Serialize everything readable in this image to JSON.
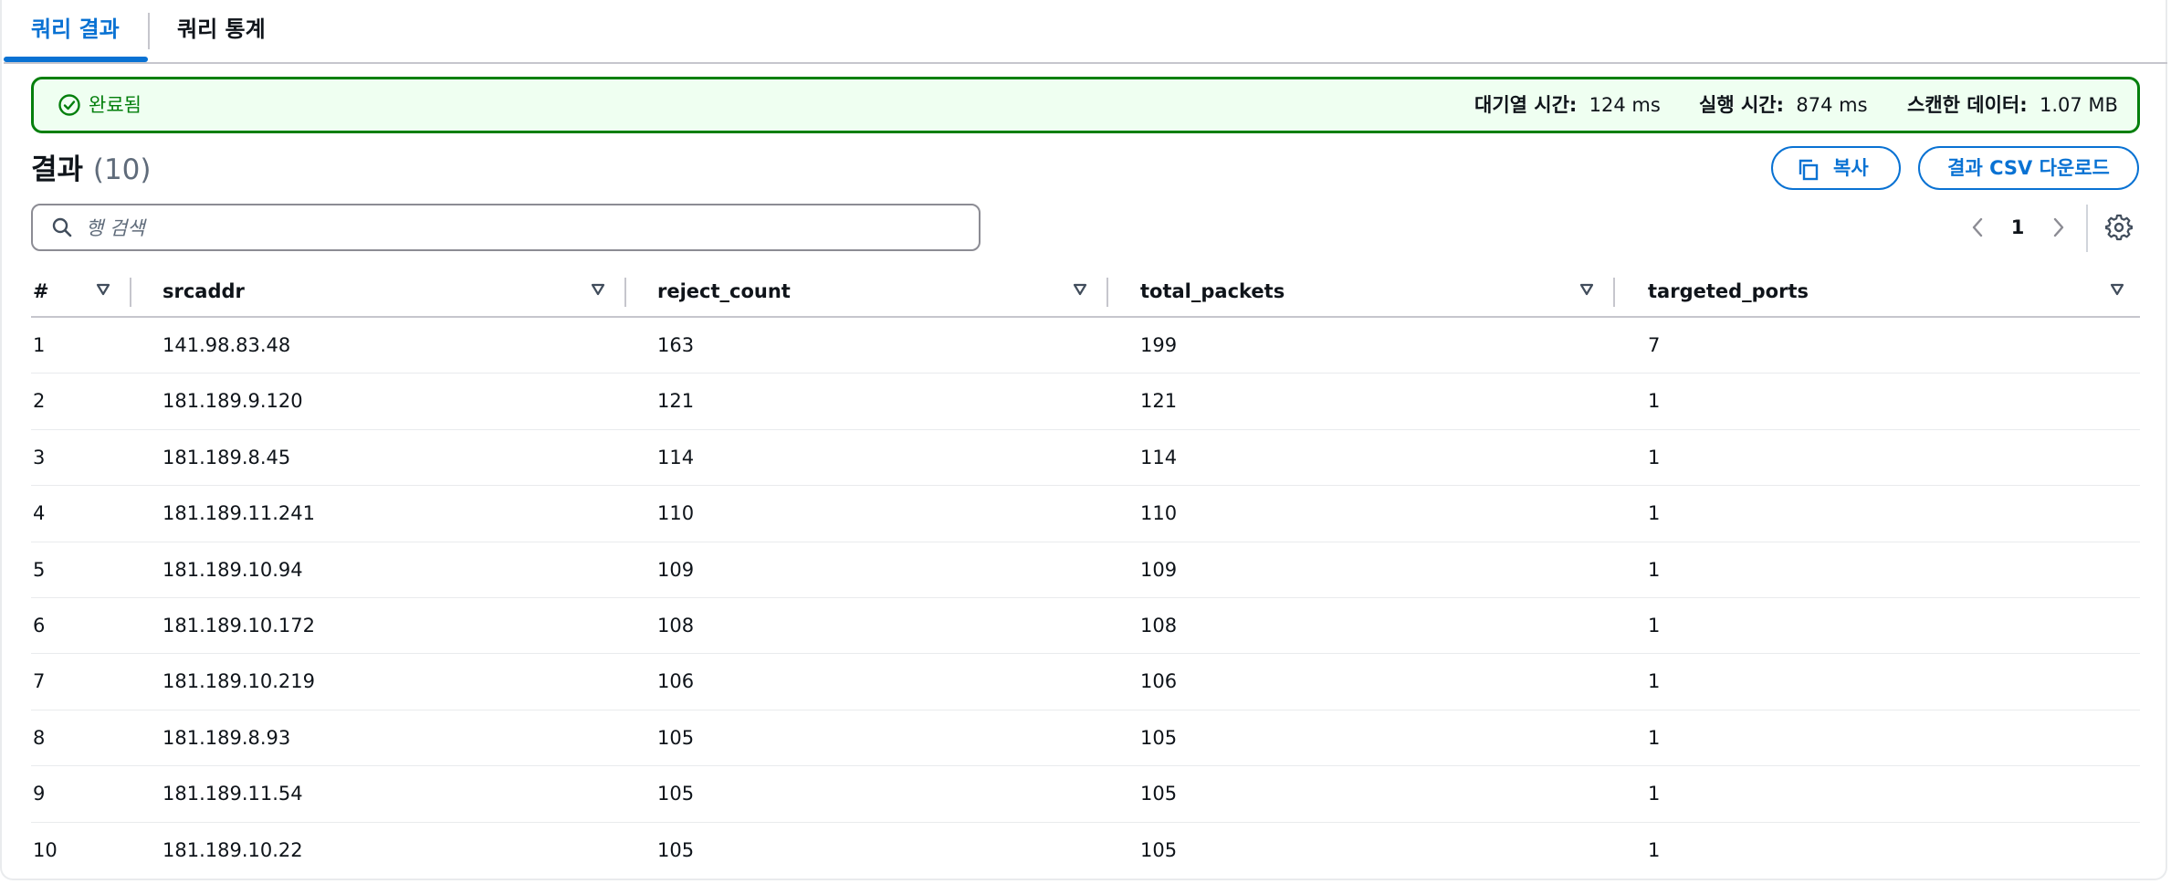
{
  "tabs": [
    {
      "label": "쿼리 결과",
      "active": true
    },
    {
      "label": "쿼리 통계",
      "active": false
    }
  ],
  "status": {
    "text": "완료됨",
    "color": "#037f0c",
    "queue_time_label": "대기열 시간:",
    "queue_time_value": "124 ms",
    "run_time_label": "실행 시간:",
    "run_time_value": "874 ms",
    "scanned_label": "스캔한 데이터:",
    "scanned_value": "1.07 MB"
  },
  "results": {
    "title": "결과",
    "count": "(10)",
    "copy_label": "복사",
    "csv_label": "결과 CSV 다운로드"
  },
  "search": {
    "placeholder": "행 검색",
    "value": ""
  },
  "pagination": {
    "current": "1"
  },
  "table": {
    "columns": [
      "#",
      "srcaddr",
      "reject_count",
      "total_packets",
      "targeted_ports"
    ],
    "rows": [
      [
        "1",
        "141.98.83.48",
        "163",
        "199",
        "7"
      ],
      [
        "2",
        "181.189.9.120",
        "121",
        "121",
        "1"
      ],
      [
        "3",
        "181.189.8.45",
        "114",
        "114",
        "1"
      ],
      [
        "4",
        "181.189.11.241",
        "110",
        "110",
        "1"
      ],
      [
        "5",
        "181.189.10.94",
        "109",
        "109",
        "1"
      ],
      [
        "6",
        "181.189.10.172",
        "108",
        "108",
        "1"
      ],
      [
        "7",
        "181.189.10.219",
        "106",
        "106",
        "1"
      ],
      [
        "8",
        "181.189.8.93",
        "105",
        "105",
        "1"
      ],
      [
        "9",
        "181.189.11.54",
        "105",
        "105",
        "1"
      ],
      [
        "10",
        "181.189.10.22",
        "105",
        "105",
        "1"
      ]
    ]
  },
  "colors": {
    "accent": "#0972d3",
    "success": "#037f0c",
    "success_bg": "#effff1"
  }
}
